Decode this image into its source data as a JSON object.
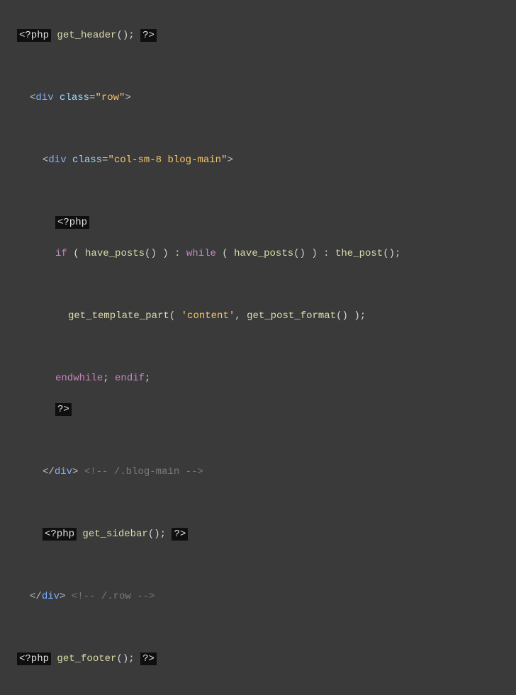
{
  "code": {
    "l1": {
      "phpOpen": "<?php",
      "fn": "get_header",
      "phpClose": "?>"
    },
    "l3": {
      "tag": "div",
      "attr": "class",
      "val": "\"row\""
    },
    "l5": {
      "tag": "div",
      "attr": "class",
      "val": "\"col-sm-8 blog-main\""
    },
    "l7": {
      "phpOpen": "<?php"
    },
    "l8": {
      "kw_if": "if",
      "fn1": "have_posts",
      "kw_while": "while",
      "fn2": "have_posts",
      "fn3": "the_post"
    },
    "l10": {
      "fn1": "get_template_part",
      "str": "'content'",
      "fn2": "get_post_format"
    },
    "l12": {
      "kw1": "endwhile",
      "kw2": "endif"
    },
    "l13": {
      "phpClose": "?>"
    },
    "l15": {
      "tag": "div",
      "comment": "<!-- /.blog-main -->"
    },
    "l17": {
      "phpOpen": "<?php",
      "fn": "get_sidebar",
      "phpClose": "?>"
    },
    "l19": {
      "tag": "div",
      "comment": "<!-- /.row -->"
    },
    "l21": {
      "phpOpen": "<?php",
      "fn": "get_footer",
      "phpClose": "?>"
    }
  }
}
